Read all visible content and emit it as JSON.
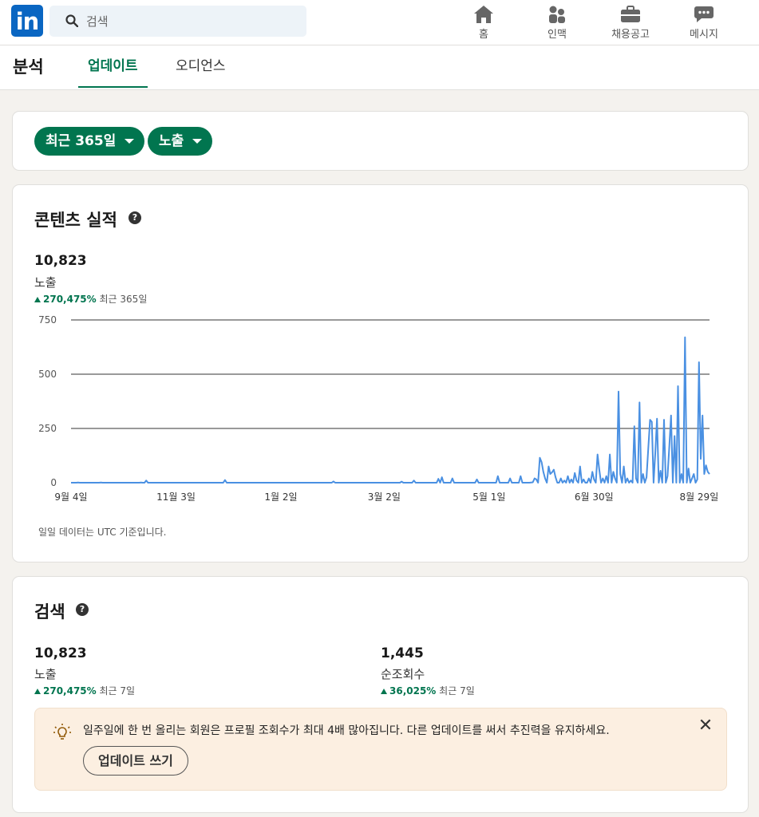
{
  "nav": {
    "logo": "in",
    "search_placeholder": "검색",
    "items": [
      {
        "label": "홈",
        "icon": "home-icon"
      },
      {
        "label": "인맥",
        "icon": "people-icon"
      },
      {
        "label": "채용공고",
        "icon": "briefcase-icon"
      },
      {
        "label": "메시지",
        "icon": "message-icon"
      }
    ]
  },
  "header": {
    "title": "분석",
    "tabs": [
      "업데이트",
      "오디언스"
    ],
    "active_tab": "업데이트"
  },
  "filters": {
    "period": "최근 365일",
    "metric": "노출"
  },
  "content_performance": {
    "title": "콘텐츠 실적",
    "value": "10,823",
    "label": "노출",
    "change": "270,475%",
    "period": "최근 365일",
    "note": "일일 데이터는 UTC 기준입니다."
  },
  "chart_data": {
    "type": "line",
    "ylim": [
      0,
      750
    ],
    "yticks": [
      "750",
      "500",
      "250",
      "0"
    ],
    "xticks": [
      "9월 4일",
      "11월 3일",
      "1월 2일",
      "3월 2일",
      "5월 1일",
      "6월 30일",
      "8월 29일"
    ],
    "x_start": "9월 4일",
    "x_end": "8월 29일",
    "color": "#4a90e2",
    "values": [
      0,
      0,
      0,
      0,
      1,
      0,
      0,
      0,
      0,
      0,
      0,
      0,
      0,
      0,
      0,
      0,
      0,
      1,
      0,
      0,
      0,
      0,
      0,
      0,
      0,
      0,
      0,
      0,
      0,
      0,
      0,
      0,
      0,
      0,
      0,
      0,
      0,
      0,
      0,
      0,
      1,
      0,
      0,
      0,
      0,
      0,
      0,
      0,
      0,
      0,
      0,
      0,
      0,
      0,
      0,
      0,
      0,
      0,
      0,
      0,
      0,
      0,
      0,
      0,
      0,
      0,
      0,
      0,
      0,
      0,
      0,
      0,
      0,
      0,
      0,
      0,
      0,
      0,
      0,
      0,
      0,
      0,
      0,
      0,
      0,
      0,
      0,
      0,
      0,
      0,
      0,
      0,
      0,
      0,
      0,
      0,
      0,
      0,
      0,
      0,
      0,
      0,
      0,
      0,
      0,
      0,
      0,
      0,
      0,
      0,
      0,
      0,
      0,
      0,
      0,
      0,
      0,
      0,
      0,
      0,
      0,
      0,
      0,
      0,
      0,
      0,
      0,
      0,
      0,
      0,
      0,
      0,
      0,
      0,
      0,
      0,
      0,
      0,
      0,
      0,
      0,
      0,
      0,
      0,
      0,
      0,
      0,
      0,
      0,
      0,
      0,
      0,
      0,
      0,
      0,
      0,
      0,
      0,
      0,
      0,
      0,
      0,
      0,
      0,
      0,
      0,
      0,
      0,
      0,
      0,
      0,
      0,
      0,
      0,
      0,
      0,
      0,
      0,
      0,
      0,
      0,
      0,
      0,
      0,
      0,
      0,
      0,
      0,
      0,
      0,
      0,
      0,
      0,
      0,
      0,
      0,
      0,
      0,
      0,
      0,
      0,
      0,
      0,
      0,
      0,
      0,
      0,
      0,
      0,
      0,
      0,
      0,
      0,
      0,
      0,
      0,
      0,
      0,
      0,
      0,
      0,
      0,
      0,
      0,
      0,
      0,
      0,
      0,
      0,
      0,
      0,
      0,
      0,
      0,
      0,
      0,
      0,
      0,
      0,
      0,
      0,
      0,
      0,
      0,
      0,
      0,
      0,
      0,
      0,
      0,
      0,
      0,
      0,
      0,
      0,
      0,
      0,
      0,
      0,
      0,
      0,
      0,
      0,
      0,
      0,
      0,
      0,
      0,
      0,
      0,
      0,
      0,
      0,
      0,
      0,
      0,
      0,
      0,
      0,
      0,
      0,
      0,
      0,
      0,
      0,
      0,
      0,
      0,
      0,
      0,
      0,
      0,
      0,
      0,
      0,
      0,
      0,
      0,
      0,
      0,
      0,
      0,
      0,
      0,
      0,
      0,
      0,
      0,
      0,
      0,
      0,
      0,
      0,
      0,
      0,
      0,
      0,
      0,
      0,
      0,
      0,
      0,
      0,
      0,
      0,
      0,
      0,
      0,
      0,
      0,
      0,
      0,
      0,
      0,
      0,
      0,
      0,
      0,
      0,
      0,
      0,
      0,
      0,
      0,
      0,
      0,
      0,
      0,
      0,
      0,
      0,
      0,
      0,
      0,
      0,
      0,
      0,
      0,
      0,
      0,
      0,
      0,
      0,
      0,
      0,
      0
    ]
  },
  "search": {
    "title": "검색",
    "metrics": [
      {
        "value": "10,823",
        "label": "노출",
        "change": "270,475%",
        "period": "최근 7일"
      },
      {
        "value": "1,445",
        "label": "순조회수",
        "change": "36,025%",
        "period": "최근 7일"
      }
    ],
    "tip_text": "일주일에 한 번 올리는 회원은 프로필 조회수가 최대 4배 많아집니다. 다른 업데이트를 써서 추진력을 유지하세요.",
    "tip_button": "업데이트 쓰기"
  }
}
